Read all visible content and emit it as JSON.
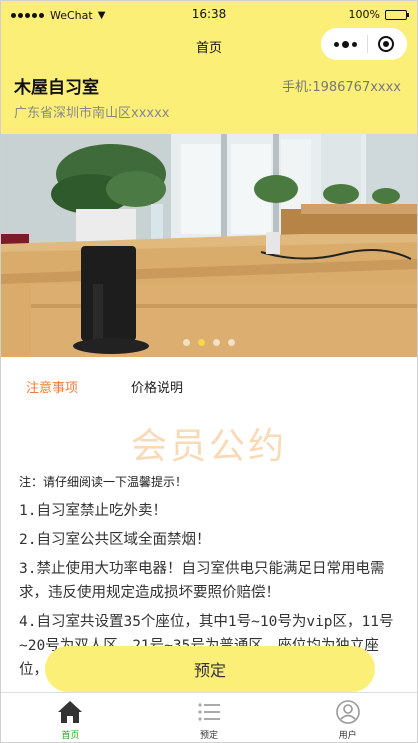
{
  "status_bar": {
    "carrier": "WeChat",
    "time": "16:38",
    "battery": "100%",
    "battery_level": 1.0
  },
  "nav": {
    "title": "首页",
    "capsule_icons": [
      "more-dots-icon",
      "target-icon"
    ]
  },
  "shop": {
    "name": "木屋自习室",
    "phone": "手机:1986767xxxx",
    "address": "广东省深圳市南山区xxxxx"
  },
  "banner": {
    "dot_count": 4,
    "active_dot": 1
  },
  "tabs": [
    {
      "label": "注意事项",
      "active": true
    },
    {
      "label": "价格说明",
      "active": false
    }
  ],
  "content": {
    "watermark": "会员公约",
    "note": "注：请仔细阅读一下温馨提示！",
    "rules": [
      "1.自习室禁止吃外卖！",
      "2.自习室公共区域全面禁烟！",
      "3.禁止使用大功率电器！自习室供电只能满足日常用电需求，违反使用规定造成损坏要照价赔偿！",
      "4.自习室共设置35个座位，其中1号~10号为vip区，11号~20号为双人区，21号~35号为普通区。座位均为独立座位，座椅……"
    ]
  },
  "book_button": "预定",
  "tabbar": [
    {
      "label": "首页",
      "icon": "home-icon",
      "active": true
    },
    {
      "label": "预定",
      "icon": "list-icon",
      "active": false
    },
    {
      "label": "用户",
      "icon": "user-icon",
      "active": false
    }
  ],
  "colors": {
    "header_bg": "#fbef78",
    "tab_active": "#f07c3c",
    "tabbar_active": "#1aad19",
    "watermark": "#f8d9b8"
  }
}
